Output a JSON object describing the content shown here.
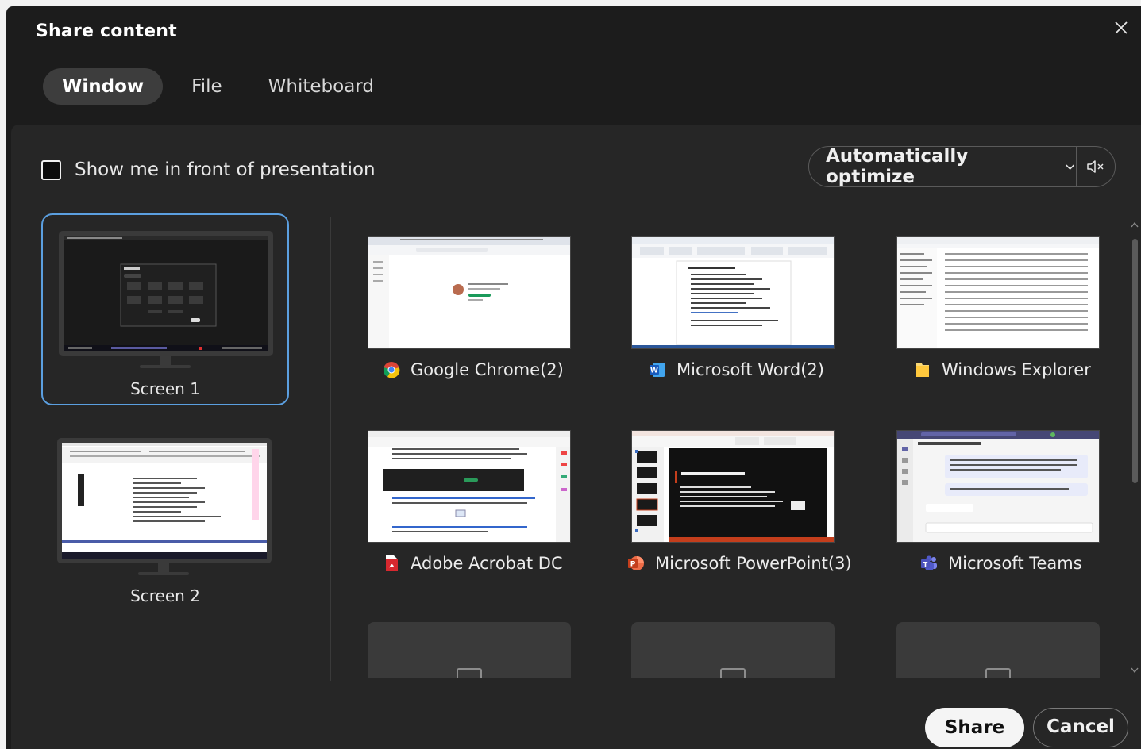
{
  "dialog": {
    "title": "Share content",
    "close_icon": "close-icon"
  },
  "tabs": [
    {
      "label": "Window",
      "active": true
    },
    {
      "label": "File",
      "active": false
    },
    {
      "label": "Whiteboard",
      "active": false
    }
  ],
  "options": {
    "show_me_label": "Show me in front of presentation",
    "show_me_checked": false,
    "optimize_label": "Automatically optimize",
    "audio_icon": "speaker-muted-icon"
  },
  "screens": [
    {
      "label": "Screen 1",
      "selected": true
    },
    {
      "label": "Screen 2",
      "selected": false
    }
  ],
  "windows": [
    {
      "label": "Google Chrome(2)",
      "icon": "chrome-icon"
    },
    {
      "label": "Microsoft Word(2)",
      "icon": "word-icon"
    },
    {
      "label": "Windows Explorer",
      "icon": "folder-icon"
    },
    {
      "label": "Adobe Acrobat DC",
      "icon": "acrobat-icon"
    },
    {
      "label": "Microsoft PowerPoint(3)",
      "icon": "powerpoint-icon"
    },
    {
      "label": "Microsoft Teams",
      "icon": "teams-icon"
    }
  ],
  "colors": {
    "accent_selected": "#5b9fe0",
    "dialog_bg": "#1c1c1c",
    "panel_bg": "#262626"
  },
  "actions": {
    "share_label": "Share",
    "cancel_label": "Cancel"
  }
}
